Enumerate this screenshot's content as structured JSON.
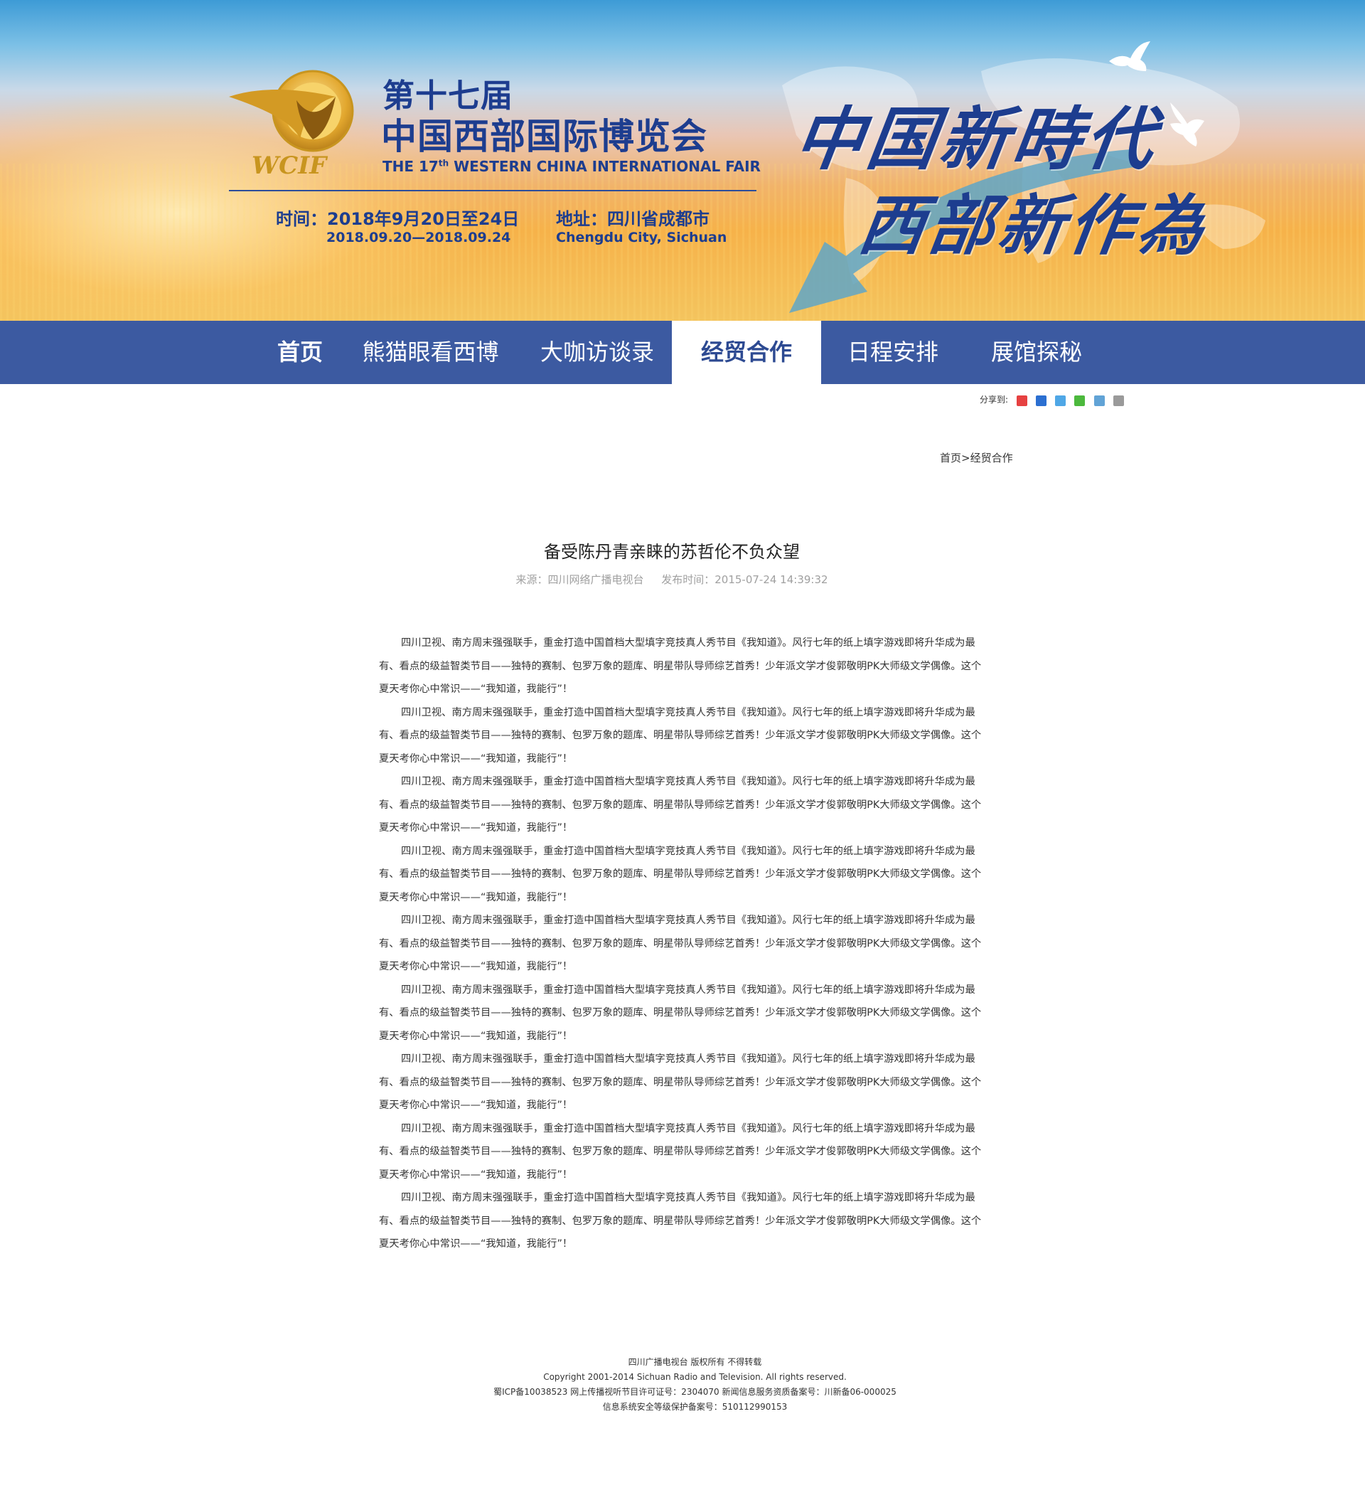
{
  "banner": {
    "logo_text": "WCIF",
    "logo_ring_text": "中国西部国际博览会 WESTERN CHINA INTERNATIONAL FAIR",
    "edition_cn": "第十七届",
    "fair_name_cn": "中国西部国际博览会",
    "fair_name_en_prefix": "THE 17",
    "fair_name_en_sup": "th",
    "fair_name_en_suffix": " WESTERN CHINA INTERNATIONAL FAIR",
    "date_cn": "时间：2018年9月20日至24日",
    "date_en": "2018.09.20—2018.09.24",
    "address_cn": "地址：四川省成都市",
    "address_en": "Chengdu City, Sichuan",
    "slogan_line1": "中国新時代",
    "slogan_line2": "西部新作為"
  },
  "nav": {
    "items": [
      {
        "label": "首页"
      },
      {
        "label": "熊猫眼看西博"
      },
      {
        "label": "大咖访谈录"
      },
      {
        "label": "经贸合作"
      },
      {
        "label": "日程安排"
      },
      {
        "label": "展馆探秘"
      }
    ],
    "active_index": 3
  },
  "share": {
    "label": "分享到:",
    "icons": [
      "weibo-icon",
      "qzone-icon",
      "qq-icon",
      "wechat-icon",
      "renren-icon",
      "more-share-icon"
    ]
  },
  "breadcrumb": {
    "home": "首页",
    "separator": ">",
    "current": "经贸合作"
  },
  "article": {
    "title": "备受陈丹青亲睐的苏哲伦不负众望",
    "source": "来源：四川网络广播电视台",
    "published": "发布时间：2015-07-24 14:39:32",
    "paragraphs": [
      "四川卫视、南方周末强强联手，重金打造中国首档大型填字竞技真人秀节目《我知道》。风行七年的纸上填字游戏即将升华成为最有、看点的级益智类节目——独特的赛制、包罗万象的题库、明星带队导师综艺首秀！少年派文学才俊郭敬明PK大师级文学偶像。这个夏天考你心中常识——“我知道，我能行”！",
      "四川卫视、南方周末强强联手，重金打造中国首档大型填字竞技真人秀节目《我知道》。风行七年的纸上填字游戏即将升华成为最有、看点的级益智类节目——独特的赛制、包罗万象的题库、明星带队导师综艺首秀！少年派文学才俊郭敬明PK大师级文学偶像。这个夏天考你心中常识——“我知道，我能行”！",
      "四川卫视、南方周末强强联手，重金打造中国首档大型填字竞技真人秀节目《我知道》。风行七年的纸上填字游戏即将升华成为最有、看点的级益智类节目——独特的赛制、包罗万象的题库、明星带队导师综艺首秀！少年派文学才俊郭敬明PK大师级文学偶像。这个夏天考你心中常识——“我知道，我能行”！",
      "四川卫视、南方周末强强联手，重金打造中国首档大型填字竞技真人秀节目《我知道》。风行七年的纸上填字游戏即将升华成为最有、看点的级益智类节目——独特的赛制、包罗万象的题库、明星带队导师综艺首秀！少年派文学才俊郭敬明PK大师级文学偶像。这个夏天考你心中常识——“我知道，我能行”！",
      "四川卫视、南方周末强强联手，重金打造中国首档大型填字竞技真人秀节目《我知道》。风行七年的纸上填字游戏即将升华成为最有、看点的级益智类节目——独特的赛制、包罗万象的题库、明星带队导师综艺首秀！少年派文学才俊郭敬明PK大师级文学偶像。这个夏天考你心中常识——“我知道，我能行”！",
      "四川卫视、南方周末强强联手，重金打造中国首档大型填字竞技真人秀节目《我知道》。风行七年的纸上填字游戏即将升华成为最有、看点的级益智类节目——独特的赛制、包罗万象的题库、明星带队导师综艺首秀！少年派文学才俊郭敬明PK大师级文学偶像。这个夏天考你心中常识——“我知道，我能行”！",
      "四川卫视、南方周末强强联手，重金打造中国首档大型填字竞技真人秀节目《我知道》。风行七年的纸上填字游戏即将升华成为最有、看点的级益智类节目——独特的赛制、包罗万象的题库、明星带队导师综艺首秀！少年派文学才俊郭敬明PK大师级文学偶像。这个夏天考你心中常识——“我知道，我能行”！",
      "四川卫视、南方周末强强联手，重金打造中国首档大型填字竞技真人秀节目《我知道》。风行七年的纸上填字游戏即将升华成为最有、看点的级益智类节目——独特的赛制、包罗万象的题库、明星带队导师综艺首秀！少年派文学才俊郭敬明PK大师级文学偶像。这个夏天考你心中常识——“我知道，我能行”！",
      "四川卫视、南方周末强强联手，重金打造中国首档大型填字竞技真人秀节目《我知道》。风行七年的纸上填字游戏即将升华成为最有、看点的级益智类节目——独特的赛制、包罗万象的题库、明星带队导师综艺首秀！少年派文学才俊郭敬明PK大师级文学偶像。这个夏天考你心中常识——“我知道，我能行”！"
    ]
  },
  "footer": {
    "line1": "四川广播电视台 版权所有 不得转载",
    "line2": "Copyright 2001-2014 Sichuan Radio and Television. All rights reserved.",
    "line3": "蜀ICP备10038523    网上传播视听节目许可证号：2304070 新闻信息服务资质备案号：川新备06-000025",
    "line4": "信息系统安全等级保护备案号：510112990153"
  },
  "colors": {
    "nav_bg": "#3c5aa1",
    "brand_blue": "#1d3d8f",
    "active_nav_text": "#2d4a92",
    "meta_gray": "#a0a0a0"
  }
}
